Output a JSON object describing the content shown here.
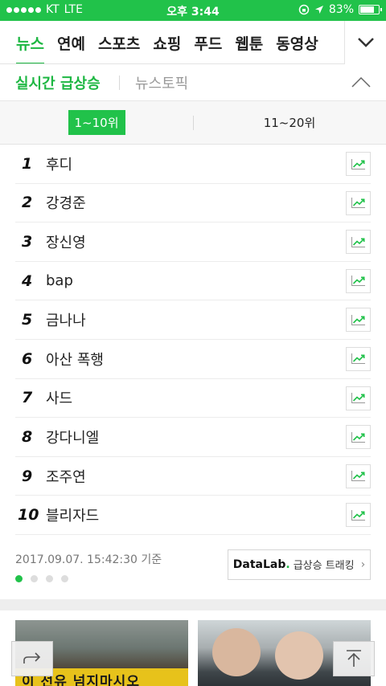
{
  "status_bar": {
    "carrier": "KT",
    "network": "LTE",
    "time": "오후 3:44",
    "battery": "83%",
    "battery_level": 0.83
  },
  "nav": {
    "tabs": [
      {
        "label": "뉴스",
        "active": true
      },
      {
        "label": "연예",
        "active": false
      },
      {
        "label": "스포츠",
        "active": false
      },
      {
        "label": "쇼핑",
        "active": false
      },
      {
        "label": "푸드",
        "active": false
      },
      {
        "label": "웹툰",
        "active": false
      },
      {
        "label": "동영상",
        "active": false
      }
    ],
    "more_icon": "chevron-down-icon"
  },
  "section": {
    "title": "실시간 급상승",
    "alt_tab": "뉴스토픽",
    "collapse_icon": "chevron-up-icon"
  },
  "ranges": [
    "1~10위",
    "11~20위"
  ],
  "ranking": [
    {
      "rank": "1",
      "keyword": "후디"
    },
    {
      "rank": "2",
      "keyword": "강경준"
    },
    {
      "rank": "3",
      "keyword": "장신영"
    },
    {
      "rank": "4",
      "keyword": "bap"
    },
    {
      "rank": "5",
      "keyword": "금나나"
    },
    {
      "rank": "6",
      "keyword": "아산 폭행"
    },
    {
      "rank": "7",
      "keyword": "사드"
    },
    {
      "rank": "8",
      "keyword": "강다니엘"
    },
    {
      "rank": "9",
      "keyword": "조주연"
    },
    {
      "rank": "10",
      "keyword": "블리자드"
    }
  ],
  "footer": {
    "timestamp": "2017.09.07. 15:42:30 기준",
    "datalab_brand_a": "DataLab",
    "datalab_brand_dot": ".",
    "datalab_text": "급상승 트래킹",
    "page_count": 4,
    "active_page": 1
  },
  "news": {
    "thumb_a_banner": "이 선유 넘지마시오"
  },
  "colors": {
    "brand_green": "#21c24a",
    "accent_green": "#1eb743"
  }
}
